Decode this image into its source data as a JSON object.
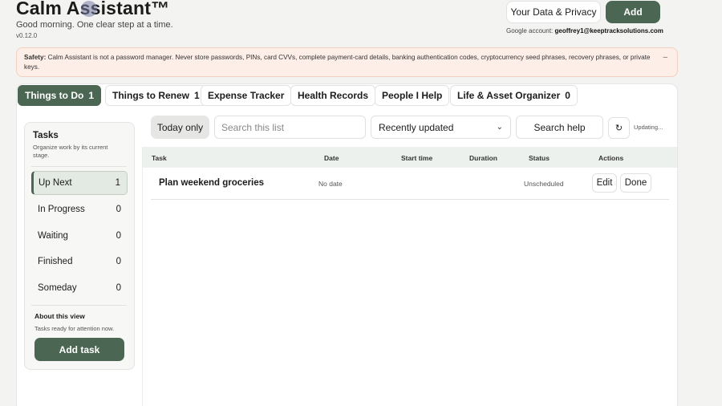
{
  "header": {
    "title": "Calm Assistant™",
    "greeting": "Good morning. One clear step at a time.",
    "version": "v0.12.0",
    "privacy_label": "Your Data & Privacy",
    "add_label": "Add",
    "account_prefix": "Google account:",
    "account_email": "geoffrey1@keeptracksolutions.com"
  },
  "safety": {
    "label": "Safety:",
    "text": "Calm Assistant is not a password manager. Never store passwords, PINs, card CVVs, complete payment-card details, banking authentication codes, cryptocurrency seed phrases, recovery phrases, or private keys.",
    "close": "–"
  },
  "tabs": [
    {
      "label": "Things to Do",
      "count": "1"
    },
    {
      "label": "Things to Renew",
      "count": "1"
    },
    {
      "label": "Expense Tracker",
      "count": ""
    },
    {
      "label": "Health Records",
      "count": ""
    },
    {
      "label": "People I Help",
      "count": ""
    },
    {
      "label": "Life & Asset Organizer",
      "count": "0"
    }
  ],
  "sidebar": {
    "title": "Tasks",
    "subtitle": "Organize work by its current stage.",
    "items": [
      {
        "label": "Up Next",
        "count": "1"
      },
      {
        "label": "In Progress",
        "count": "0"
      },
      {
        "label": "Waiting",
        "count": "0"
      },
      {
        "label": "Finished",
        "count": "0"
      },
      {
        "label": "Someday",
        "count": "0"
      }
    ],
    "about_title": "About this view",
    "about_text": "Tasks ready for attention now.",
    "add_task_label": "Add task"
  },
  "toolbar": {
    "today_only": "Today only",
    "search_placeholder": "Search this list",
    "sort_value": "Recently updated",
    "search_help": "Search help",
    "refresh_glyph": "↻",
    "updating": "Updating..."
  },
  "table": {
    "columns": [
      "Task",
      "Date",
      "Start time",
      "Duration",
      "Status",
      "Actions"
    ],
    "rows": [
      {
        "task": "Plan weekend groceries",
        "date": "No date",
        "start_time": "",
        "duration": "",
        "status": "Unscheduled",
        "edit": "Edit",
        "done": "Done"
      }
    ]
  },
  "colors": {
    "accent": "#4b6652",
    "safety_bg": "#fdeee7",
    "table_header_bg": "#edf1ed"
  }
}
